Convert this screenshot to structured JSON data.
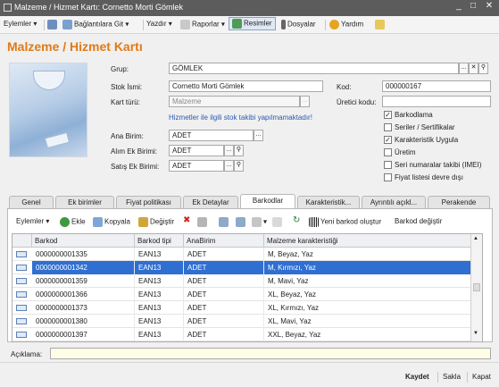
{
  "window": {
    "title": "Malzeme / Hizmet Kartı: Cornetto Morti Gömlek"
  },
  "menu": {
    "eylemler": "Eylemler",
    "baglantilar": "Bağlantılara Git",
    "yazdir": "Yazdır",
    "raporlar": "Raporlar",
    "resimler": "Resimler",
    "dosyalar": "Dosyalar",
    "yardim": "Yardım"
  },
  "page": {
    "heading": "Malzeme / Hizmet Kartı"
  },
  "form": {
    "grup_label": "Grup:",
    "grup_value": "GÖMLEK",
    "stok_label": "Stok İsmi:",
    "stok_value": "Cornetto Morti Gömlek",
    "kod_label": "Kod:",
    "kod_value": "000000167",
    "kart_label": "Kart türü:",
    "kart_value": "Malzeme",
    "uretici_label": "Üretici kodu:",
    "uretici_value": "",
    "hint_link": "Hizmetler ile ilgili stok takibi yapılmamaktadır!",
    "ana_label": "Ana Birim:",
    "ana_value": "ADET",
    "alim_label": "Alım Ek Birimi:",
    "alim_value": "ADET",
    "satis_label": "Satış Ek Birimi:",
    "satis_value": "ADET"
  },
  "checkboxes": [
    {
      "label": "Barkodlama",
      "checked": true
    },
    {
      "label": "Seriler / Sertifikalar",
      "checked": false
    },
    {
      "label": "Karakteristik Uygula",
      "checked": true
    },
    {
      "label": "Üretim",
      "checked": false
    },
    {
      "label": "Seri numaralar takibi (IMEI)",
      "checked": false
    },
    {
      "label": "Fiyat listesi devre dışı",
      "checked": false
    }
  ],
  "tabs": [
    "Genel",
    "Ek birimler",
    "Fiyat politikası",
    "Ek Detaylar",
    "Barkodlar",
    "Karakteristik...",
    "Ayrıntılı açıkl...",
    "Perakende"
  ],
  "selected_tab": "Barkodlar",
  "toolbar2": {
    "eylemler": "Eylemler",
    "ekle": "Ekle",
    "kopyala": "Kopyala",
    "degistir": "Değiştir",
    "yeni_barkod": "Yeni barkod oluştur",
    "barkod_degistir": "Barkod değiştir"
  },
  "grid": {
    "columns": [
      "Barkod",
      "Barkod tipi",
      "AnaBirim",
      "Malzeme karakteristiği"
    ],
    "rows": [
      {
        "barkod": "0000000001335",
        "tip": "EAN13",
        "birim": "ADET",
        "kar": "M, Beyaz, Yaz"
      },
      {
        "barkod": "0000000001342",
        "tip": "EAN13",
        "birim": "ADET",
        "kar": "M, Kırmızı, Yaz"
      },
      {
        "barkod": "0000000001359",
        "tip": "EAN13",
        "birim": "ADET",
        "kar": "M, Mavi, Yaz"
      },
      {
        "barkod": "0000000001366",
        "tip": "EAN13",
        "birim": "ADET",
        "kar": "XL, Beyaz, Yaz"
      },
      {
        "barkod": "0000000001373",
        "tip": "EAN13",
        "birim": "ADET",
        "kar": "XL, Kırmızı, Yaz"
      },
      {
        "barkod": "0000000001380",
        "tip": "EAN13",
        "birim": "ADET",
        "kar": "XL, Mavi, Yaz"
      },
      {
        "barkod": "0000000001397",
        "tip": "EAN13",
        "birim": "ADET",
        "kar": "XXL, Beyaz, Yaz"
      }
    ],
    "selected_row": 1
  },
  "aciklama": {
    "label": "Açıklama:",
    "value": ""
  },
  "footer": {
    "kaydet": "Kaydet",
    "sakla": "Sakla",
    "kapat": "Kapat"
  },
  "colors": {
    "accent": "#e07a16",
    "selection": "#2f6fd1",
    "link": "#2a59b5"
  }
}
